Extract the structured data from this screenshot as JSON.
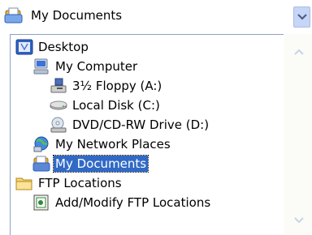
{
  "combo": {
    "value": "My Documents"
  },
  "items": [
    {
      "label": "Desktop"
    },
    {
      "label": "My Computer"
    },
    {
      "label": "3½ Floppy (A:)"
    },
    {
      "label": "Local Disk (C:)"
    },
    {
      "label": "DVD/CD-RW Drive (D:)"
    },
    {
      "label": "My Network Places"
    },
    {
      "label": "My Documents"
    },
    {
      "label": "FTP Locations"
    },
    {
      "label": "Add/Modify FTP Locations"
    }
  ],
  "selected_item": "My Documents"
}
